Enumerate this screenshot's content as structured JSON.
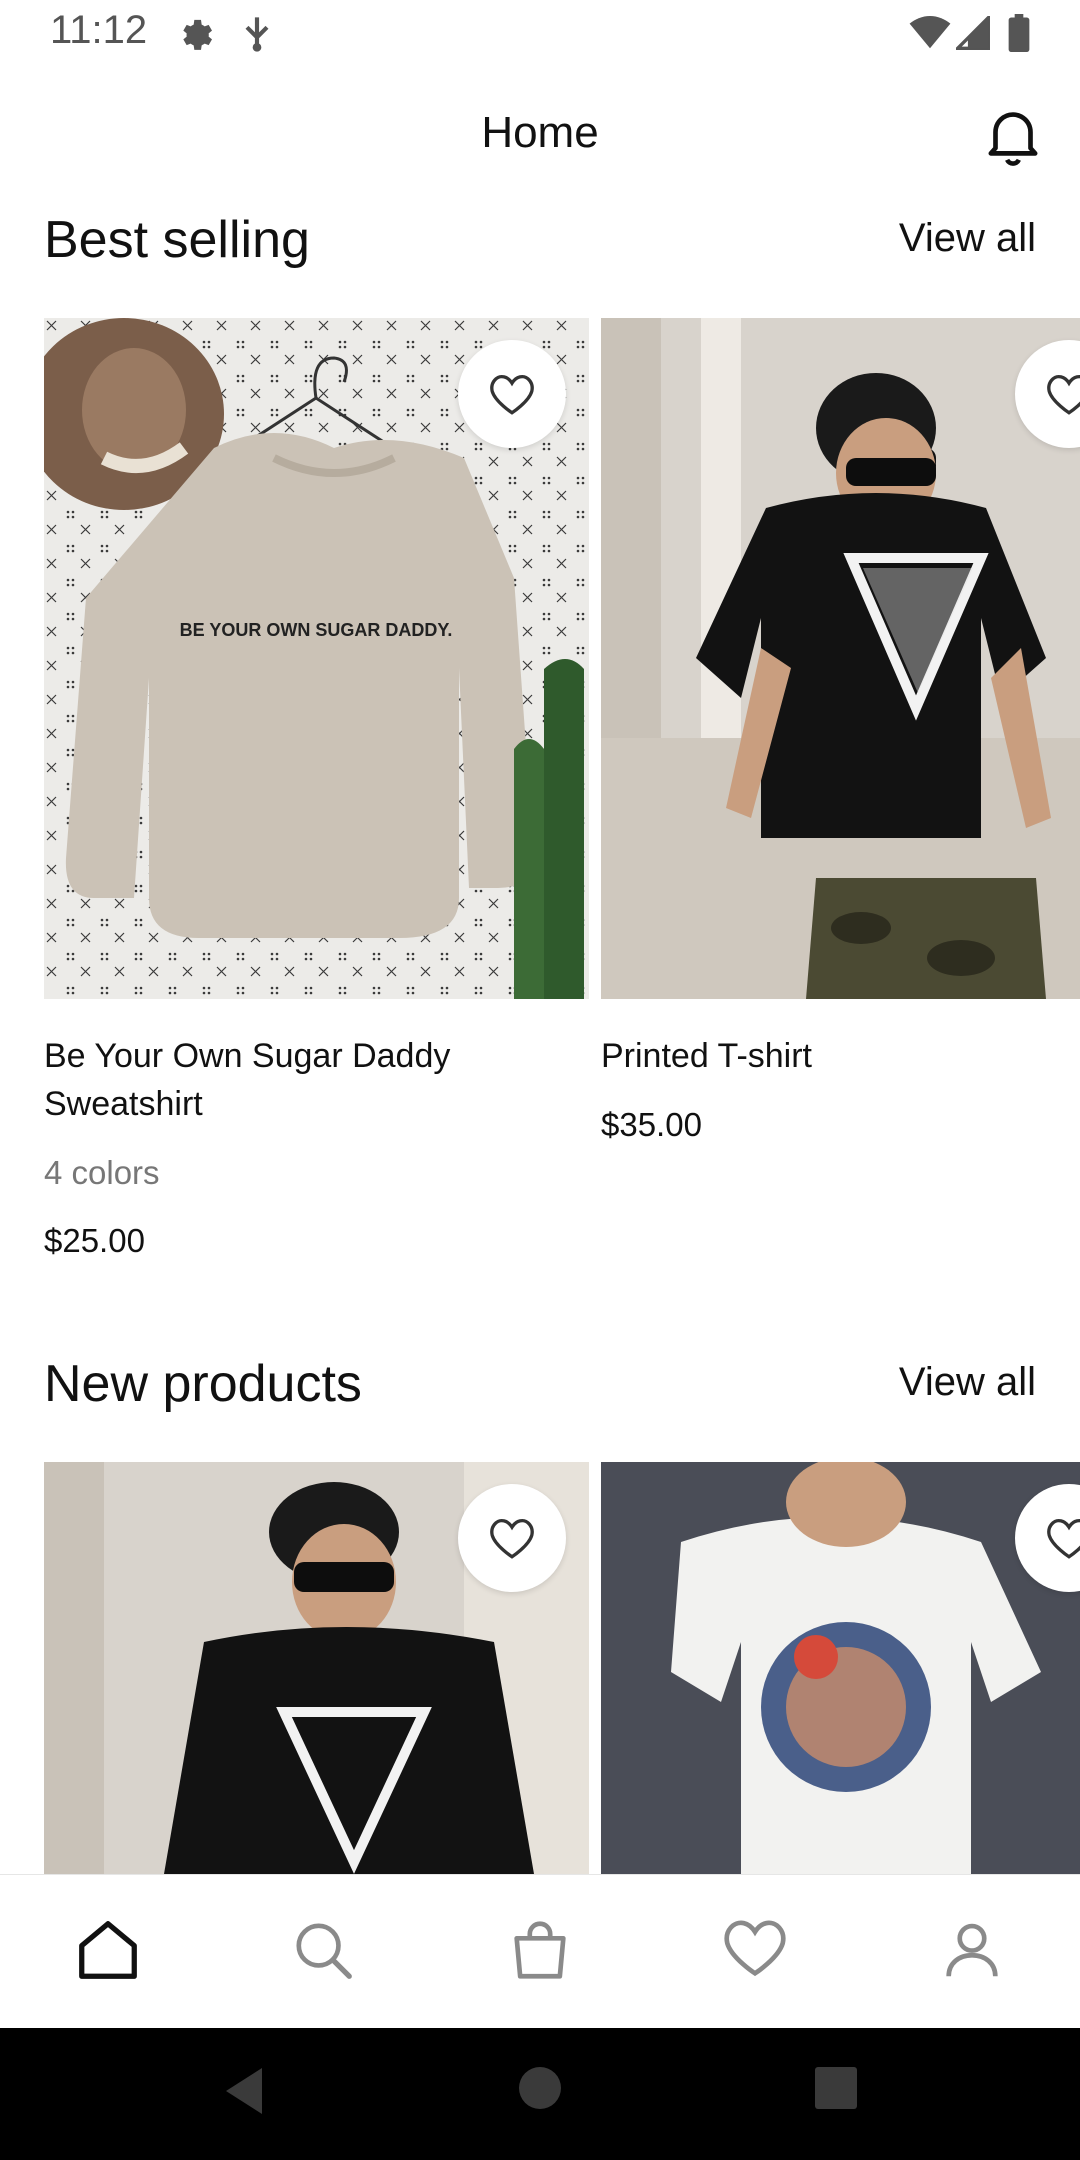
{
  "status_bar": {
    "time": "11:12",
    "icons": [
      "gear-icon",
      "usb-icon",
      "wifi-icon",
      "signal-icon",
      "battery-icon"
    ]
  },
  "app_bar": {
    "title": "Home",
    "notification_icon": "bell-icon"
  },
  "sections": {
    "best_selling": {
      "title": "Best selling",
      "view_all": "View all",
      "products": [
        {
          "name": "Be Your Own Sugar Daddy Sweatshirt",
          "colors": "4 colors",
          "price": "$25.00",
          "print": "BE YOUR OWN SUGAR DADDY."
        },
        {
          "name": "Printed T-shirt",
          "price": "$35.00"
        }
      ]
    },
    "new_products": {
      "title": "New products",
      "view_all": "View all"
    }
  },
  "bottom_nav": {
    "items": [
      "home-icon",
      "search-icon",
      "bag-icon",
      "heart-icon",
      "profile-icon"
    ],
    "active": "home-icon"
  },
  "colors": {
    "text": "#111111",
    "muted": "#777777",
    "background": "#ffffff",
    "sys_nav": "#000000"
  }
}
